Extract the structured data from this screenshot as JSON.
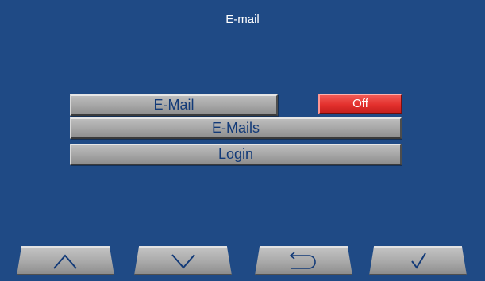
{
  "header": {
    "title": "E-mail"
  },
  "menu": {
    "email_label": "E-Mail",
    "email_toggle": "Off",
    "emails_label": "E-Mails",
    "login_label": "Login"
  },
  "nav": {
    "icons": [
      "chevron-up-icon",
      "chevron-down-icon",
      "return-arrow-icon",
      "checkmark-icon"
    ]
  },
  "colors": {
    "background": "#1f4a85",
    "button_gray": "#a7a7a7",
    "button_text": "#123a78",
    "toggle_off_red": "#e3302d"
  }
}
